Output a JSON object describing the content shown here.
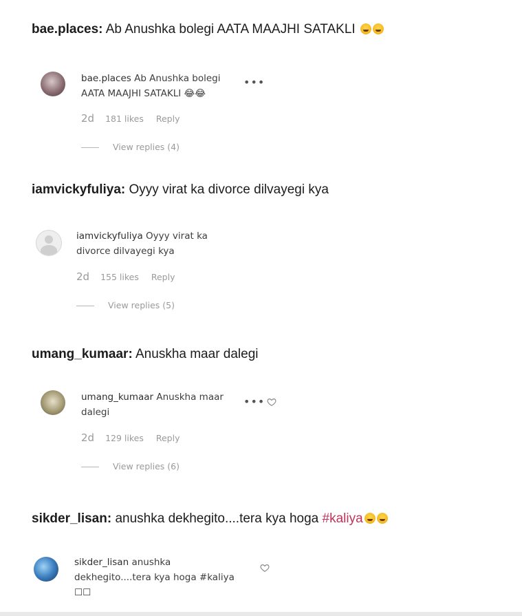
{
  "posts": [
    {
      "headline_user": "bae.places:",
      "headline_text": " Ab Anushka bolegi AATA MAAJHI SATAKLI ",
      "headline_emojis": [
        "laughing-tears",
        "laughing-tears"
      ],
      "card_user": "bae.places",
      "card_line1": " Ab Anushka bolegi",
      "card_line2": "AATA MAAJHI SATAKLI 😂😂",
      "age": "2d",
      "likes": "181 likes",
      "reply": "Reply",
      "view_replies": "View replies (4)"
    },
    {
      "headline_user": "iamvickyfuliya:",
      "headline_text": " Oyyy virat ka divorce dilvayegi kya",
      "card_user": "iamvickyfuliya",
      "card_line1": " Oyyy virat ka",
      "card_line2": "divorce dilvayegi kya",
      "age": "2d",
      "likes": "155 likes",
      "reply": "Reply",
      "view_replies": "View replies (5)"
    },
    {
      "headline_user": "umang_kumaar:",
      "headline_text": " Anuskha maar dalegi",
      "card_user": "umang_kumaar",
      "card_line1": " Anuskha maar",
      "card_line2": "dalegi",
      "age": "2d",
      "likes": "129 likes",
      "reply": "Reply",
      "view_replies": "View replies (6)"
    },
    {
      "headline_user": "sikder_lisan:",
      "headline_text": " anushka dekhegito....tera kya hoga ",
      "headline_hashtag": "#kaliya",
      "headline_emojis": [
        "rolling-laughing",
        "rolling-laughing"
      ],
      "card_user": "sikder_lisan",
      "card_line1": " anushka",
      "card_line2": "dekhegito....tera kya hoga #kaliya",
      "card_line3": "☐☐"
    }
  ],
  "icons": {
    "more": "more-options-icon",
    "like": "heart-icon"
  },
  "colors": {
    "hashtag": "#c0325a",
    "muted": "#9a9a9a"
  }
}
